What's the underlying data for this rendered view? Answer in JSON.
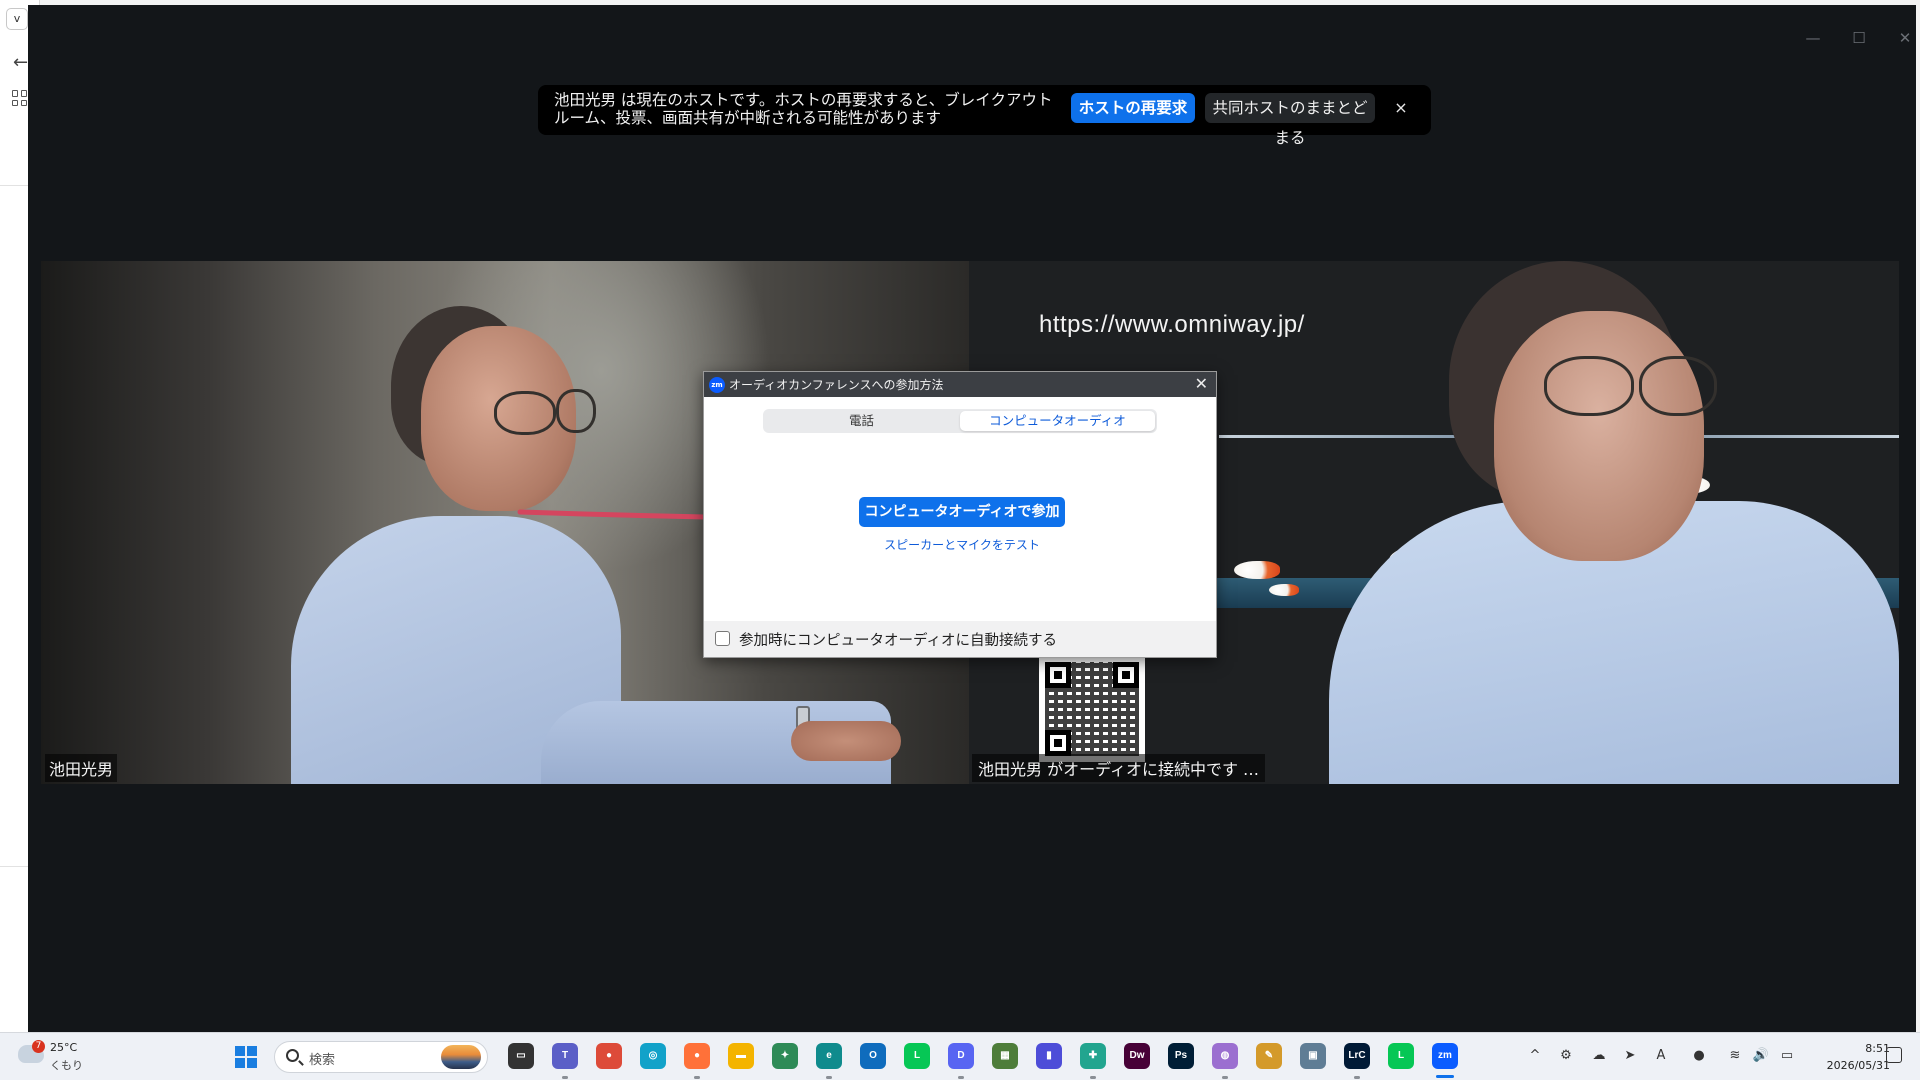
{
  "zoom": {
    "host_banner": {
      "message": "池田光男 は現在のホストです。ホストの再要求すると、ブレイクアウト ルーム、投票、画面共有が中断される可能性があります",
      "reclaim_button": "ホストの再要求",
      "stay_button": "共同ホストのままとどまる",
      "close": "×"
    },
    "window_controls": {
      "minimize": "—",
      "maximize": "☐",
      "close": "✕"
    },
    "videos": [
      {
        "participant_label": "池田光男"
      },
      {
        "overlay_url": "https://www.omniway.jp/",
        "participant_label": "池田光男 がオーディオに接続中です …"
      }
    ],
    "audio_dialog": {
      "title": "オーディオカンファレンスへの参加方法",
      "logo_text": "zm",
      "tabs": [
        "電話",
        "コンピュータオーディオ"
      ],
      "selected_tab": "コンピュータオーディオ",
      "join_button": "コンピュータオーディオで参加",
      "test_link": "スピーカーとマイクをテスト",
      "auto_connect_label": "参加時にコンピュータオーディオに自動接続する",
      "auto_connect_checked": false,
      "close": "✕"
    },
    "annotation": {
      "color": "#d4465f"
    }
  },
  "taskbar": {
    "weather": {
      "badge": "7",
      "temperature": "25°C",
      "condition": "くもり"
    },
    "search_placeholder": "検索",
    "apps": [
      {
        "name": "task-view",
        "label": "▭",
        "color": "#333333"
      },
      {
        "name": "teams",
        "label": "T",
        "color": "#5b5fc7"
      },
      {
        "name": "chrome",
        "label": "●",
        "color": "#dd4b39"
      },
      {
        "name": "copilot",
        "label": "◎",
        "color": "#12a2c9"
      },
      {
        "name": "firefox",
        "label": "●",
        "color": "#ff7139"
      },
      {
        "name": "file-explorer",
        "label": "▬",
        "color": "#f4b400"
      },
      {
        "name": "app-green",
        "label": "✦",
        "color": "#2e8b57"
      },
      {
        "name": "edge",
        "label": "e",
        "color": "#0f8b8d"
      },
      {
        "name": "outlook",
        "label": "O",
        "color": "#0f6cbd"
      },
      {
        "name": "line-work",
        "label": "L",
        "color": "#06c755"
      },
      {
        "name": "discord",
        "label": "D",
        "color": "#5865f2"
      },
      {
        "name": "app-colorful",
        "label": "▦",
        "color": "#4e7d3a"
      },
      {
        "name": "audio-app",
        "label": "▮",
        "color": "#4d4dd8"
      },
      {
        "name": "app-teal",
        "label": "✚",
        "color": "#22a58f"
      },
      {
        "name": "dreamweaver",
        "label": "Dw",
        "color": "#470137"
      },
      {
        "name": "photoshop",
        "label": "Ps",
        "color": "#001e36"
      },
      {
        "name": "app-purple",
        "label": "◍",
        "color": "#9b6fd0"
      },
      {
        "name": "app-paint",
        "label": "✎",
        "color": "#d49a2a"
      },
      {
        "name": "app-screen",
        "label": "▣",
        "color": "#5f7d95"
      },
      {
        "name": "lightroom",
        "label": "LrC",
        "color": "#001a36"
      },
      {
        "name": "line",
        "label": "L",
        "color": "#06c755"
      },
      {
        "name": "zoom",
        "label": "zm",
        "color": "#0b5cff"
      }
    ],
    "tray": [
      "^",
      "⚙",
      "☁",
      "➤",
      "A",
      "●",
      "≋",
      "🔊",
      "▭"
    ],
    "clock": {
      "time": "8:51",
      "date": "2026/05/31"
    }
  }
}
